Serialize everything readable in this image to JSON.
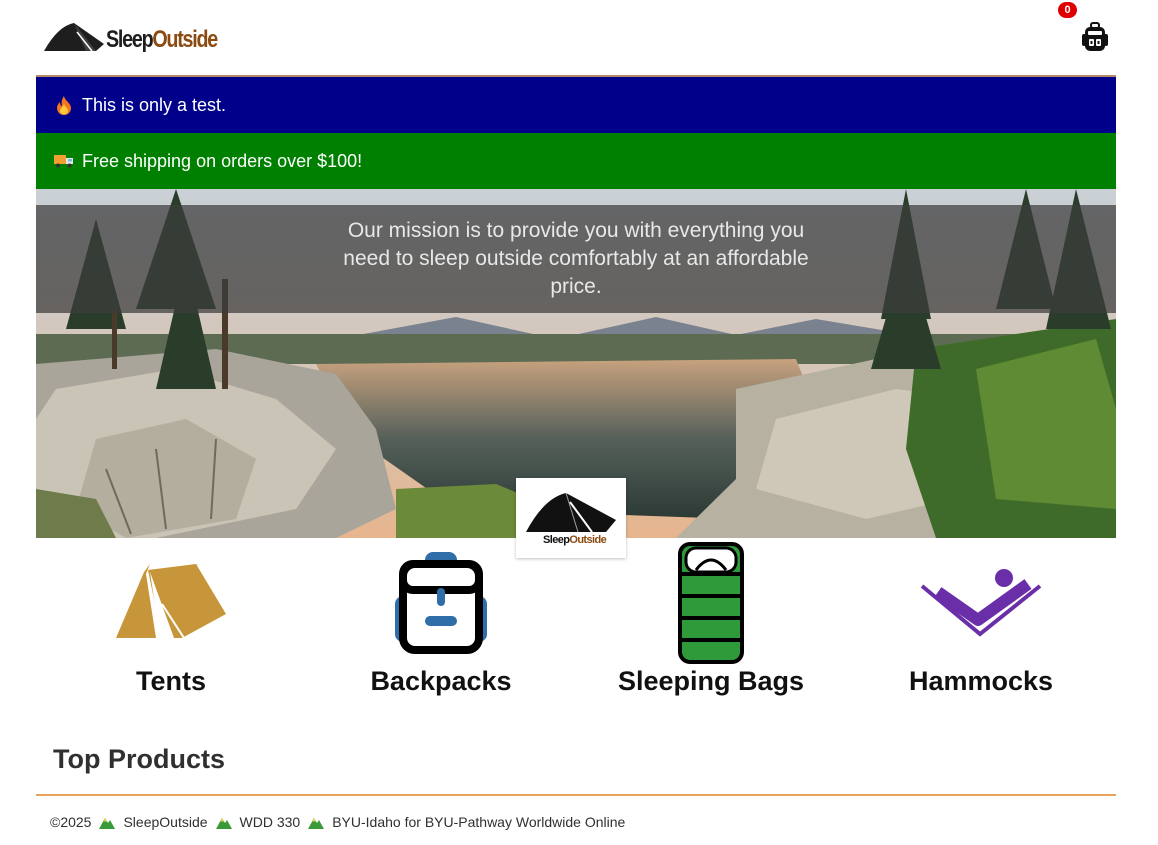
{
  "header": {
    "logo_sleep": "Sleep",
    "logo_outside": "Outside",
    "cart_count": "0"
  },
  "banners": [
    {
      "emoji": "fire-icon",
      "text": "This is only a test.",
      "color": "#00008b"
    },
    {
      "emoji": "delivery-truck-icon",
      "text": "Free shipping on orders over $100!",
      "color": "#008000"
    }
  ],
  "hero": {
    "mission": "Our mission is to provide you with everything you need to sleep outside comfortably at an affordable price.",
    "logo_sleep": "Sleep",
    "logo_outside": "Outside"
  },
  "categories": [
    {
      "label": "Tents",
      "icon": "tent-icon",
      "color": "#c8963a"
    },
    {
      "label": "Backpacks",
      "icon": "backpack-icon",
      "color": "#2f6ea8"
    },
    {
      "label": "Sleeping Bags",
      "icon": "sleeping-bag-icon",
      "color": "#2e9a3a"
    },
    {
      "label": "Hammocks",
      "icon": "hammock-icon",
      "color": "#6a2fa8"
    }
  ],
  "top_products": {
    "heading": "Top Products"
  },
  "footer": {
    "copyright": "©2025",
    "items": [
      "SleepOutside",
      "WDD 330",
      "BYU-Idaho for BYU-Pathway Worldwide Online"
    ]
  }
}
